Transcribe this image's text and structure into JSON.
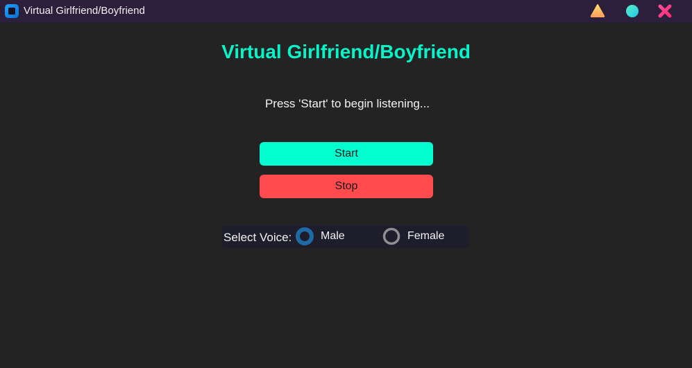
{
  "window": {
    "title": "Virtual Girlfriend/Boyfriend",
    "app_icon": "app-square-icon",
    "controls": [
      {
        "name": "minimize",
        "icon": "triangle-icon",
        "color": "#ffcc55"
      },
      {
        "name": "maximize",
        "icon": "circle-icon",
        "color": "#33e6d4"
      },
      {
        "name": "close",
        "icon": "x-icon",
        "color": "#ff3d86"
      }
    ],
    "titlebar_color": "#2b1f3c"
  },
  "main": {
    "heading": "Virtual Girlfriend/Boyfriend",
    "heading_color": "#08f3c8",
    "status": "Press 'Start' to begin listening...",
    "start_label": "Start",
    "start_color": "#03ffd0",
    "stop_label": "Stop",
    "stop_color": "#ff4a4e"
  },
  "voice": {
    "label": "Select Voice:",
    "options": [
      {
        "label": "Male",
        "selected": true
      },
      {
        "label": "Female",
        "selected": false
      }
    ],
    "selected_color": "#1f6aa5",
    "unselected_color": "#8e8e93"
  }
}
